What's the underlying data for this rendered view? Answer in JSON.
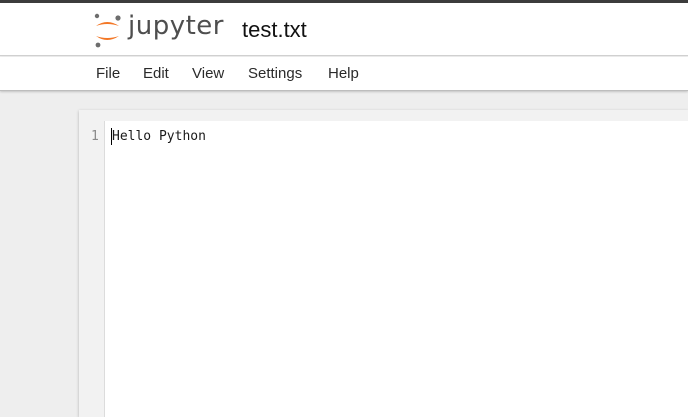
{
  "app": {
    "logo_text": "jupyter",
    "logo_icon": "jupyter-logo-icon",
    "document_title": "test.txt"
  },
  "menu": {
    "items": [
      "File",
      "Edit",
      "View",
      "Settings",
      "Help"
    ]
  },
  "editor": {
    "lines": [
      {
        "number": "1",
        "text": "Hello Python"
      }
    ]
  },
  "colors": {
    "jupyter_orange": "#f37726",
    "jupyter_gray": "#4e4e4e"
  }
}
